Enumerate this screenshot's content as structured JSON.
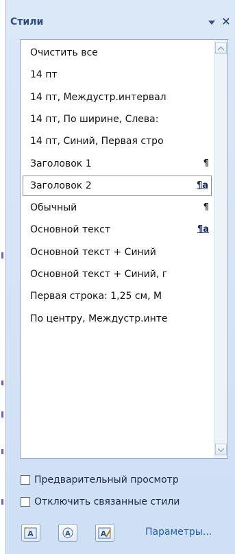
{
  "pane": {
    "title": "Стили"
  },
  "styles": [
    {
      "label": "Очистить все",
      "mark": ""
    },
    {
      "label": "14 пт",
      "mark": ""
    },
    {
      "label": "14 пт, Междустр.интервал",
      "mark": ""
    },
    {
      "label": "14 пт, По ширине, Слева:",
      "mark": ""
    },
    {
      "label": "14 пт, Синий, Первая стро",
      "mark": ""
    },
    {
      "label": "Заголовок 1",
      "mark": "¶"
    },
    {
      "label": "Заголовок 2",
      "mark": "¶a"
    },
    {
      "label": "Обычный",
      "mark": "¶"
    },
    {
      "label": "Основной текст",
      "mark": "¶a"
    },
    {
      "label": "Основной текст + Синий",
      "mark": ""
    },
    {
      "label": "Основной текст + Синий, г",
      "mark": ""
    },
    {
      "label": "Первая строка:  1,25 см, М",
      "mark": ""
    },
    {
      "label": "По центру, Междустр.инте",
      "mark": ""
    }
  ],
  "selected_index": 6,
  "options": {
    "preview_label": "Предварительный просмотр",
    "disable_linked_label": "Отключить связанные стили",
    "preview_checked": false,
    "disable_linked_checked": false
  },
  "footer": {
    "new_style_icon": "new-style-icon",
    "style_inspector_icon": "style-inspector-icon",
    "manage_styles_icon": "manage-styles-icon",
    "params_label": "Параметры..."
  },
  "colors": {
    "pane_bg": "#dbe8f8",
    "title_text": "#2c4f86",
    "link": "#1f5fb8"
  }
}
